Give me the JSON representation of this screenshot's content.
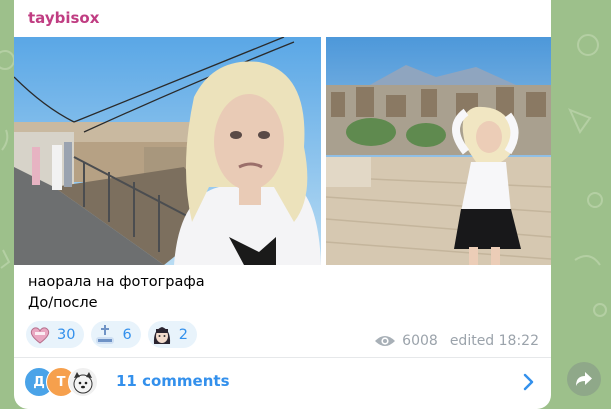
{
  "message": {
    "channel_name": "taybisox",
    "caption_lines": [
      "наорала на фотографа",
      "До/после"
    ],
    "views": "6008",
    "edited_label": "edited 18:22"
  },
  "reactions": [
    {
      "icon": "heart-sticker-icon",
      "count": "30"
    },
    {
      "icon": "simp-sticker-icon",
      "count": "6"
    },
    {
      "icon": "anime-girl-sticker-icon",
      "count": "2"
    }
  ],
  "comments": {
    "label": "11 comments",
    "avatars": [
      {
        "letter": "Д",
        "color": "#4aa3e8"
      },
      {
        "letter": "Т",
        "color": "#f6a04d"
      },
      {
        "letter": "",
        "icon": "dog-avatar-icon"
      }
    ]
  },
  "colors": {
    "channel_name": "#c03d82",
    "accent": "#3390ec",
    "background": "#9dc08b",
    "reaction_bg": "#e8f3fb"
  }
}
